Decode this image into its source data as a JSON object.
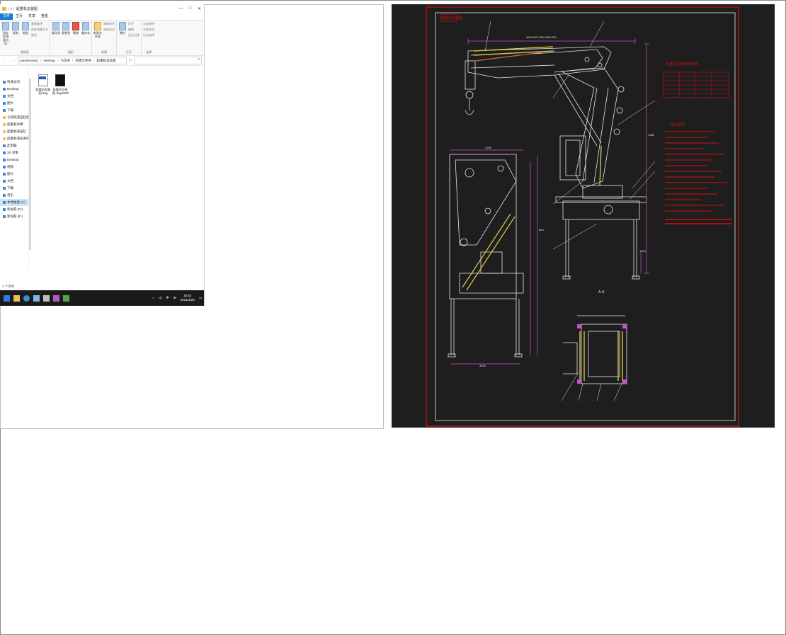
{
  "explorer": {
    "title": "起重机总装图",
    "controls": {
      "minimize": "—",
      "maximize": "□",
      "close": "✕"
    },
    "menu": [
      "文件",
      "主页",
      "共享",
      "查看"
    ],
    "ribbon": {
      "pin_label": "固定到'快速访问'",
      "copy_label": "复制",
      "paste_label": "粘贴",
      "copy_path": "复制路径",
      "paste_shortcut": "粘贴快捷方式",
      "cut": "剪切",
      "move_to": "移动到",
      "copy_to": "复制到",
      "delete": "删除",
      "rename": "重命名",
      "new_folder": "新建文件夹",
      "new_item": "新建项目",
      "easy_access": "轻松访问",
      "properties": "属性",
      "open": "打开",
      "edit": "编辑",
      "history": "历史记录",
      "select_all": "全部选择",
      "select_none": "全部取消",
      "invert": "反向选择",
      "groups": [
        "剪贴板",
        "组织",
        "新建",
        "打开",
        "选择"
      ]
    },
    "address": [
      "Administrator",
      "Desktop",
      "汽车吊",
      "新建文件夹",
      "起重机总装图"
    ],
    "sidebar": [
      {
        "label": "快速访问",
        "icon": "star-icon"
      },
      {
        "label": "Desktop",
        "icon": "desktop-icon"
      },
      {
        "label": "文档",
        "icon": "document-icon"
      },
      {
        "label": "图片",
        "icon": "picture-icon"
      },
      {
        "label": "下载",
        "icon": "download-icon"
      },
      {
        "label": "七吨吨液压起重机",
        "icon": "folder-icon"
      },
      {
        "label": "起重机吊臂",
        "icon": "folder-icon"
      },
      {
        "label": "起重机液压缸",
        "icon": "folder-icon"
      },
      {
        "label": "起重机液压系统",
        "icon": "folder-icon"
      },
      {
        "label": "此电脑",
        "icon": "pc-icon"
      },
      {
        "label": "3D 对象",
        "icon": "cube-icon"
      },
      {
        "label": "Desktop",
        "icon": "desktop-icon"
      },
      {
        "label": "视频",
        "icon": "video-icon"
      },
      {
        "label": "图片",
        "icon": "picture-icon"
      },
      {
        "label": "文档",
        "icon": "document-icon"
      },
      {
        "label": "下载",
        "icon": "download-icon"
      },
      {
        "label": "音乐",
        "icon": "music-icon"
      },
      {
        "label": "本地磁盘 (C:)",
        "icon": "disk-icon"
      },
      {
        "label": "新加卷 (D:)",
        "icon": "disk-icon"
      },
      {
        "label": "新加卷 (E:)",
        "icon": "disk-icon"
      }
    ],
    "files": [
      {
        "name": "起重机总装图.dwg",
        "icon": "dwg-file-icon"
      },
      {
        "name": "起重机总装图.dwg.BMP",
        "icon": "bmp-file-icon"
      }
    ],
    "status": "2 个项目",
    "taskbar": {
      "time": "15:52",
      "date": "2021/3/29",
      "ime": "中",
      "caret": "^"
    }
  },
  "cad": {
    "title_block": "起重机总装图",
    "table_title": "起重机主要技术参数",
    "section_label": "A-A",
    "tech_title": "技术要求",
    "dims": [
      "400+250+250+250+250",
      "1980",
      "2200",
      "860",
      "3540",
      "1900"
    ],
    "colors": {
      "frame": "#d01010",
      "cad_bg": "#1e1e1e",
      "line": "#e6e6e6",
      "dim": "#c850c8",
      "hatch": "#d6c04a"
    }
  }
}
